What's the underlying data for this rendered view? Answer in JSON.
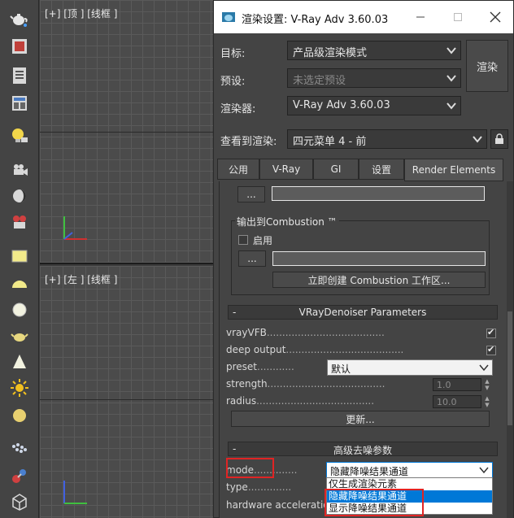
{
  "viewports": {
    "top_label": "[+] [顶 ] [线框 ]",
    "left_label": "[+] [左 ] [线框 ]"
  },
  "dialog": {
    "title": "渲染设置: V-Ray Adv 3.60.03",
    "target_label": "目标:",
    "target_value": "产品级渲染模式",
    "preset_label": "预设:",
    "preset_value": "未选定预设",
    "renderer_label": "渲染器:",
    "renderer_value": "V-Ray Adv 3.60.03",
    "view_label": "查看到渲染:",
    "view_value": "四元菜单 4 - 前",
    "render_button": "渲染"
  },
  "tabs": [
    "公用",
    "V-Ray",
    "GI",
    "设置",
    "Render Elements"
  ],
  "combustion": {
    "browse_button": "...",
    "group_title": "输出到Combustion ™",
    "enable_label": "启用",
    "browse_button2": "...",
    "create_button": "立即创建 Combustion 工作区..."
  },
  "denoiser": {
    "rollout_title": "VRayDenoiser Parameters",
    "minus": "-",
    "vrayvfb_label": "vrayVFB",
    "deep_output_label": "deep output",
    "preset_label": "preset",
    "preset_value": "默认",
    "strength_label": "strength",
    "strength_value": "1.0",
    "radius_label": "radius",
    "radius_value": "10.0",
    "update_button": "更新..."
  },
  "advanced": {
    "rollout_title": "高级去噪参数",
    "minus": "-",
    "mode_label": "mode",
    "mode_value": "隐藏降噪结果通道",
    "type_label": "type",
    "hardware_label": "hardware acceleration",
    "dropdown_options": [
      "仅生成渲染元素",
      "隐藏降噪结果通道",
      "显示降噪结果通道"
    ],
    "dots": "..............",
    "dots_long": "......................................",
    "dots_short": "............"
  }
}
